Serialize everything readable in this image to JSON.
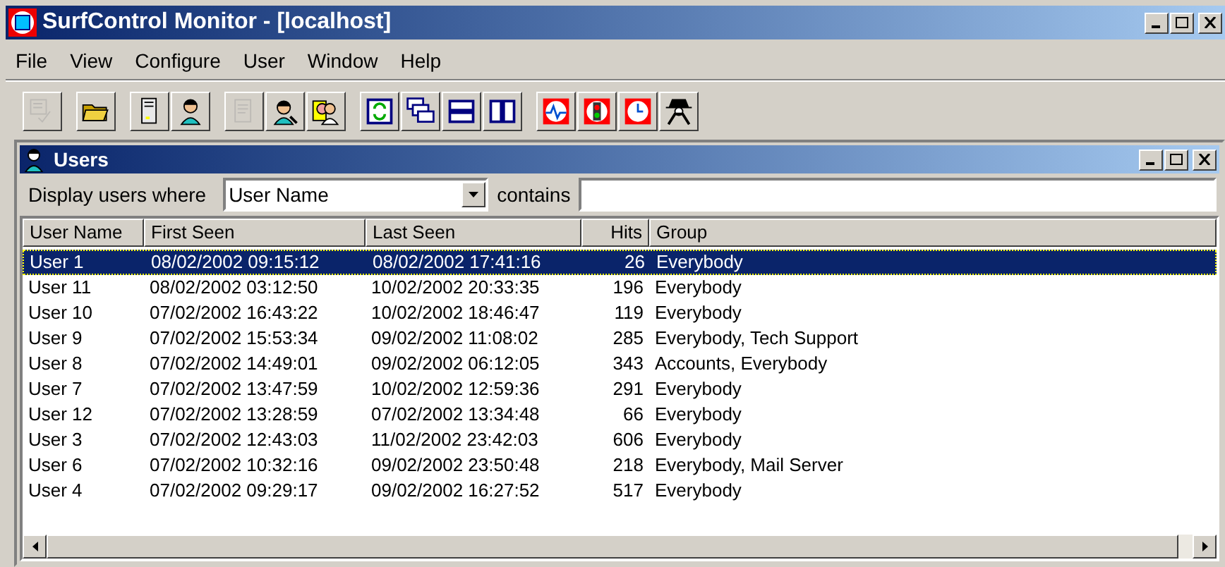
{
  "window": {
    "title": "SurfControl Monitor - [localhost]"
  },
  "menu": [
    "File",
    "View",
    "Configure",
    "User",
    "Window",
    "Help"
  ],
  "toolbar": [
    [
      {
        "disabled": true
      }
    ],
    [
      {
        "disabled": false
      }
    ],
    [
      {
        "disabled": false
      },
      {
        "disabled": false
      }
    ],
    [
      {
        "disabled": true
      },
      {
        "disabled": false
      },
      {
        "disabled": false
      }
    ],
    [
      {
        "disabled": false
      },
      {
        "disabled": false
      },
      {
        "disabled": false
      },
      {
        "disabled": false
      }
    ],
    [
      {
        "disabled": false
      },
      {
        "disabled": false
      },
      {
        "disabled": false
      },
      {
        "disabled": false
      }
    ]
  ],
  "child_window": {
    "title": "Users"
  },
  "filter": {
    "label": "Display users where",
    "field": "User Name",
    "operator": "contains"
  },
  "table": {
    "columns": [
      "User Name",
      "First Seen",
      "Last Seen",
      "Hits",
      "Group"
    ],
    "rows": [
      {
        "cells": [
          "User 1",
          "08/02/2002 09:15:12",
          "08/02/2002 17:41:16",
          "26",
          "Everybody"
        ],
        "selected": true
      },
      {
        "cells": [
          "User 11",
          "08/02/2002 03:12:50",
          "10/02/2002 20:33:35",
          "196",
          "Everybody"
        ],
        "selected": false
      },
      {
        "cells": [
          "User 10",
          "07/02/2002 16:43:22",
          "10/02/2002 18:46:47",
          "119",
          "Everybody"
        ],
        "selected": false
      },
      {
        "cells": [
          "User 9",
          "07/02/2002 15:53:34",
          "09/02/2002 11:08:02",
          "285",
          "Everybody, Tech Support"
        ],
        "selected": false
      },
      {
        "cells": [
          "User 8",
          "07/02/2002 14:49:01",
          "09/02/2002 06:12:05",
          "343",
          "Accounts, Everybody"
        ],
        "selected": false
      },
      {
        "cells": [
          "User 7",
          "07/02/2002 13:47:59",
          "10/02/2002 12:59:36",
          "291",
          "Everybody"
        ],
        "selected": false
      },
      {
        "cells": [
          "User 12",
          "07/02/2002 13:28:59",
          "07/02/2002 13:34:48",
          "66",
          "Everybody"
        ],
        "selected": false
      },
      {
        "cells": [
          "User 3",
          "07/02/2002 12:43:03",
          "11/02/2002 23:42:03",
          "606",
          "Everybody"
        ],
        "selected": false
      },
      {
        "cells": [
          "User 6",
          "07/02/2002 10:32:16",
          "09/02/2002 23:50:48",
          "218",
          "Everybody, Mail Server"
        ],
        "selected": false
      },
      {
        "cells": [
          "User 4",
          "07/02/2002 09:29:17",
          "09/02/2002 16:27:52",
          "517",
          "Everybody"
        ],
        "selected": false
      }
    ]
  }
}
